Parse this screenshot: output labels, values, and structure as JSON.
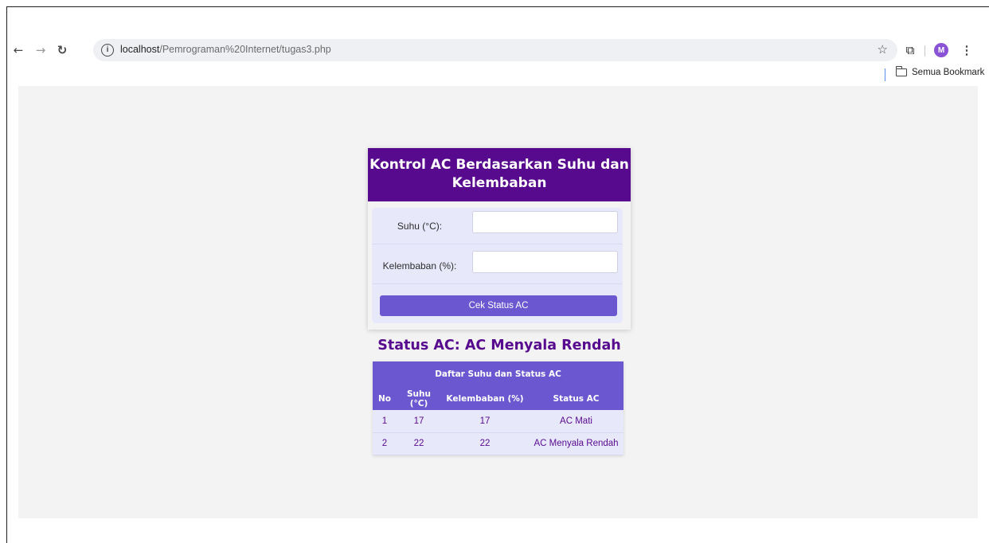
{
  "browser": {
    "url_host": "localhost",
    "url_path": "/Pemrograman%20Internet/tugas3.php",
    "avatar_letter": "M",
    "bookmark_folder": "Semua Bookmark"
  },
  "card": {
    "title": "Kontrol AC Berdasarkan Suhu dan Kelembaban",
    "suhu_label": "Suhu (°C):",
    "suhu_value": "",
    "kelembaban_label": "Kelembaban (%):",
    "kelembaban_value": "",
    "submit_label": "Cek Status AC"
  },
  "status": "Status AC: AC Menyala Rendah",
  "table": {
    "caption": "Daftar Suhu dan Status AC",
    "headers": [
      "No",
      "Suhu (°C)",
      "Kelembaban (%)",
      "Status AC"
    ],
    "rows": [
      [
        "1",
        "17",
        "17",
        "AC Mati"
      ],
      [
        "2",
        "22",
        "22",
        "AC Menyala Rendah"
      ]
    ]
  },
  "colors": {
    "header_purple": "#570a8e",
    "accent": "#6b57cf",
    "form_bg": "#e8e8fb"
  }
}
